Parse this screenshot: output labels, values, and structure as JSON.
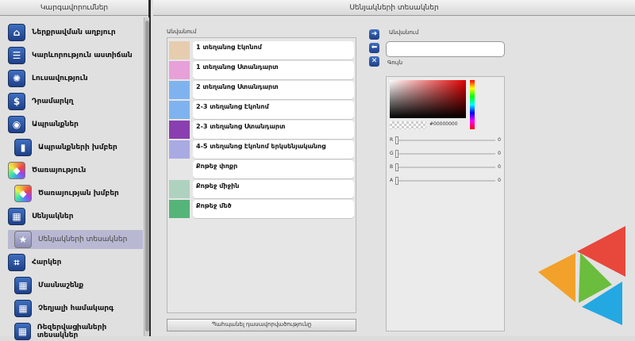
{
  "sidebar": {
    "title": "Կարգավորումներ",
    "items": [
      {
        "label": "Ներքրավման աղբյուր",
        "icon": "house-icon",
        "indent": false,
        "selected": false
      },
      {
        "label": "Կարևորություն աստիճան",
        "icon": "list-icon",
        "indent": false,
        "selected": false
      },
      {
        "label": "Լուսավություն",
        "icon": "bulb-icon",
        "indent": false,
        "selected": false
      },
      {
        "label": "Դրամարկղ",
        "icon": "dollar-icon",
        "indent": false,
        "selected": false
      },
      {
        "label": "Ապրանքներ",
        "icon": "tag-icon",
        "indent": false,
        "selected": false
      },
      {
        "label": "Ապրանքների խմբեր",
        "icon": "phone-icon",
        "indent": true,
        "selected": false
      },
      {
        "label": "Ծառայություն",
        "icon": "palette-icon",
        "indent": false,
        "selected": false
      },
      {
        "label": "Ծառայության խմբեր",
        "icon": "palette-icon",
        "indent": true,
        "selected": false
      },
      {
        "label": "Սենյակներ",
        "icon": "building-icon",
        "indent": false,
        "selected": false
      },
      {
        "label": "Սենյակների տեսակներ",
        "icon": "star-icon",
        "indent": true,
        "selected": true
      },
      {
        "label": "Հարկեր",
        "icon": "stairs-icon",
        "indent": false,
        "selected": false
      },
      {
        "label": "Մասնաշենք",
        "icon": "building-icon",
        "indent": true,
        "selected": false
      },
      {
        "label": "Չեղյալի համակարգ",
        "icon": "building-icon",
        "indent": true,
        "selected": false
      },
      {
        "label": "Ռեզերվացիաների տեսակներ",
        "icon": "building-icon",
        "indent": true,
        "selected": false
      }
    ]
  },
  "main": {
    "title": "Սենյակների տեսակներ",
    "list_label": "Անվանում",
    "room_types": [
      {
        "label": "1 տեղանոց Էկոնոմ",
        "color": "#e6cdb0"
      },
      {
        "label": "1 տեղանոց Ստանդարտ",
        "color": "#e8a0d8"
      },
      {
        "label": "2 տեղանոց Ստանդարտ",
        "color": "#7fb3f0"
      },
      {
        "label": "2-3 տեղանոց Էկոնոմ",
        "color": "#7fb3f0"
      },
      {
        "label": "2-3 տեղանոց Ստանդարտ",
        "color": "#8a3fb0"
      },
      {
        "label": "4-5 տեղանոց Էկոնոմ երկսենյականոց",
        "color": "#aaaae3"
      },
      {
        "label": "Քոթեջ փոքր",
        "color": ""
      },
      {
        "label": "Քոթեջ միջին",
        "color": "#aed2bf"
      },
      {
        "label": "Քոթեջ մեծ",
        "color": "#55b478"
      }
    ],
    "restore_button": "Պահպանել դասավորվածությունը"
  },
  "editor": {
    "name_label": "Անվանում",
    "name_value": "",
    "color_label": "Գույն",
    "hex_value": "#00000000",
    "channels": [
      {
        "label": "R",
        "value": "0"
      },
      {
        "label": "G",
        "value": "0"
      },
      {
        "label": "B",
        "value": "0"
      },
      {
        "label": "A",
        "value": "0"
      }
    ]
  },
  "tools": [
    "arrow-right-icon",
    "arrow-left-icon",
    "delete-icon"
  ]
}
